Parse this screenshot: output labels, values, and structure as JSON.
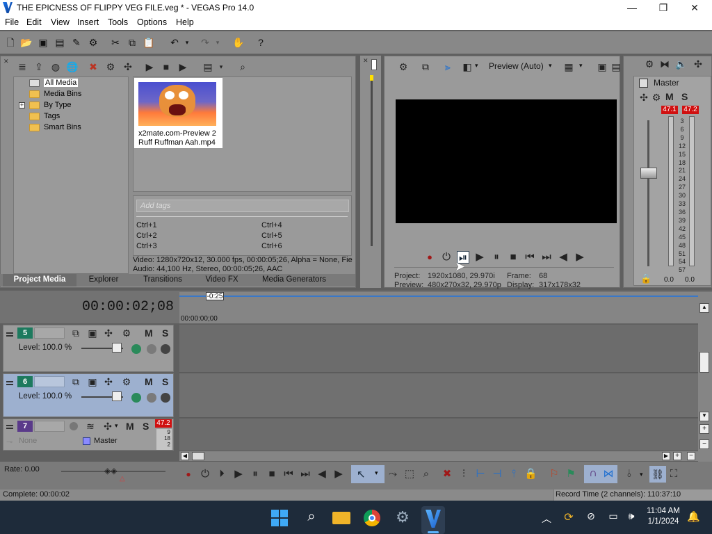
{
  "window": {
    "title": "THE EPICNESS OF FLIPPY VEG FILE.veg * - VEGAS Pro 14.0",
    "minimize": "—",
    "maximize": "❐",
    "close": "✕"
  },
  "menu": [
    "File",
    "Edit",
    "View",
    "Insert",
    "Tools",
    "Options",
    "Help"
  ],
  "explorer": {
    "tree": [
      "All Media",
      "Media Bins",
      "By Type",
      "Tags",
      "Smart Bins"
    ],
    "expand": "+",
    "media_file": {
      "name_line1": "x2mate.com-Preview 2",
      "name_line2": "Ruff Ruffman Aah.mp4"
    },
    "tags_placeholder": "Add tags",
    "shortcuts": [
      "Ctrl+1",
      "Ctrl+4",
      "Ctrl+2",
      "Ctrl+5",
      "Ctrl+3",
      "Ctrl+6"
    ],
    "video_info": "Video: 1280x720x12, 30.000 fps, 00:00:05;26, Alpha = None, Fie",
    "audio_info": "Audio: 44,100 Hz, Stereo, 00:00:05;26, AAC"
  },
  "tabs": [
    "Project Media",
    "Explorer",
    "Transitions",
    "Video FX",
    "Media Generators"
  ],
  "preview": {
    "mode": "Preview (Auto)",
    "project_label": "Project:",
    "project_value": "1920x1080, 29.970i",
    "preview_label": "Preview:",
    "preview_value": "480x270x32, 29.970p",
    "frame_label": "Frame:",
    "frame_value": "68",
    "display_label": "Display:",
    "display_value": "317x178x32"
  },
  "master": {
    "title": "Master",
    "ms_m": "M",
    "ms_s": "S",
    "peak_left": "47.1",
    "peak_right": "47.2",
    "scale": [
      "3",
      "6",
      "9",
      "12",
      "15",
      "18",
      "21",
      "24",
      "27",
      "30",
      "33",
      "36",
      "39",
      "42",
      "45",
      "48",
      "51",
      "54",
      "57"
    ],
    "bottom_left": "0.0",
    "bottom_right": "0.0"
  },
  "timeline": {
    "timecode": "00:00:02;08",
    "ruler_marker": "-0:25",
    "ruler_time": "00:00:00;00",
    "tracks": [
      {
        "num": "5",
        "level": "Level: 100.0 %",
        "m": "M",
        "s": "S"
      },
      {
        "num": "6",
        "level": "Level: 100.0 %",
        "m": "M",
        "s": "S"
      },
      {
        "num": "7",
        "level": "None",
        "bus": "Master",
        "m": "M",
        "s": "S",
        "peak": "47.2",
        "mini_scale": [
          "9",
          "18",
          "2"
        ]
      }
    ]
  },
  "rate": "Rate: 0.00",
  "status": {
    "left": "Complete: 00:00:02",
    "right": "Record Time (2 channels): 110:37:10"
  },
  "taskbar": {
    "time": "11:04 AM",
    "date": "1/1/2024"
  },
  "colors": {
    "accent": "#2ea043",
    "selected_track": "#9db0cf",
    "peak_red": "#d01010",
    "preview_bg": "#000000"
  }
}
